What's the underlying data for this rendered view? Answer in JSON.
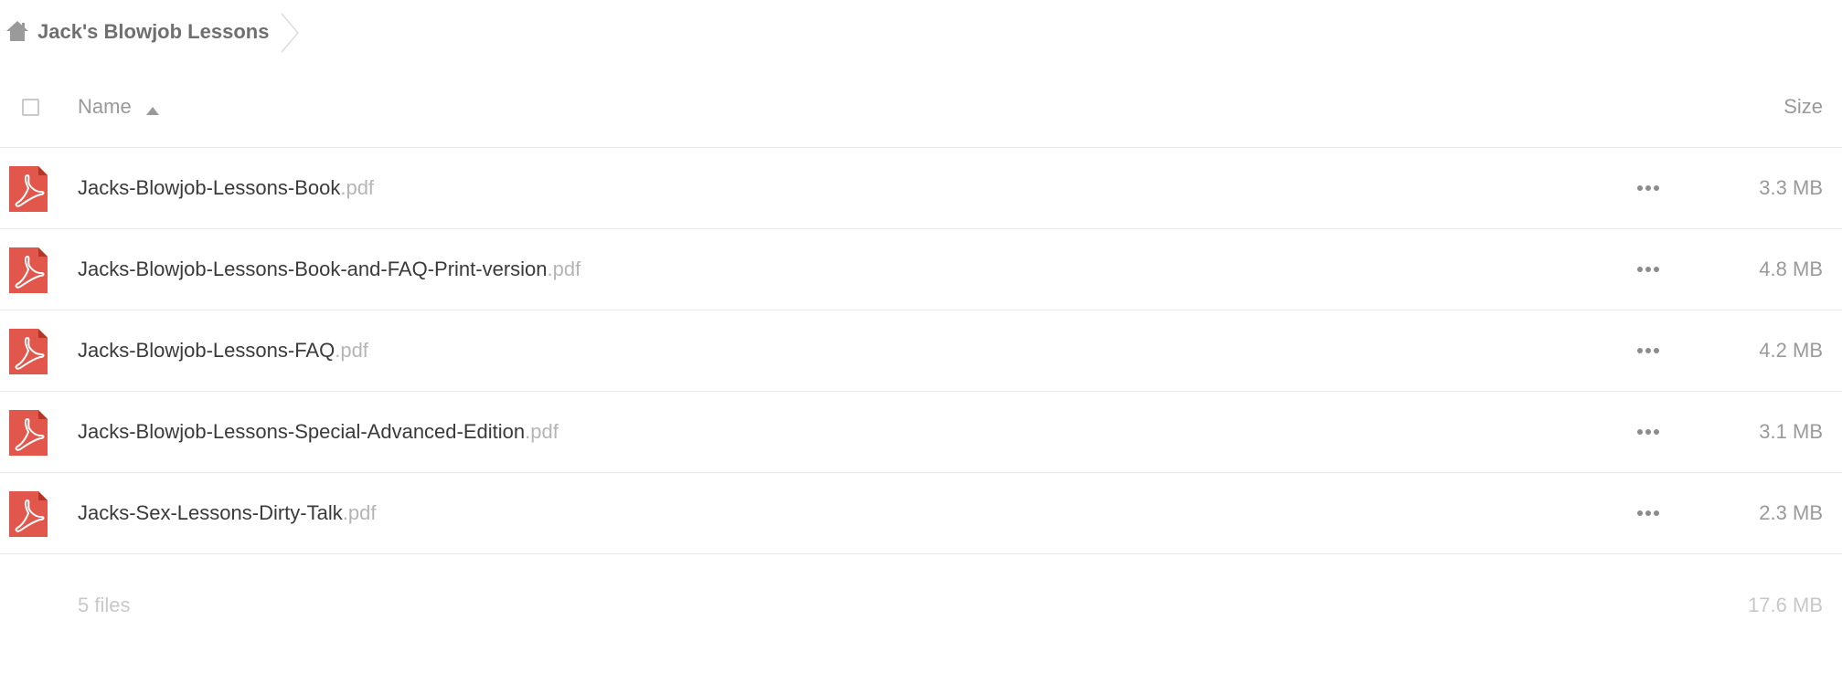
{
  "breadcrumb": {
    "home_icon": "home-icon",
    "current_folder": "Jack's Blowjob Lessons"
  },
  "header": {
    "name_label": "Name",
    "size_label": "Size",
    "sort_icon": "sort-ascending-icon"
  },
  "files": [
    {
      "base": "Jacks-Blowjob-Lessons-Book",
      "ext": ".pdf",
      "size": "3.3 MB",
      "icon": "pdf-file-icon"
    },
    {
      "base": "Jacks-Blowjob-Lessons-Book-and-FAQ-Print-version",
      "ext": ".pdf",
      "size": "4.8 MB",
      "icon": "pdf-file-icon"
    },
    {
      "base": "Jacks-Blowjob-Lessons-FAQ",
      "ext": ".pdf",
      "size": "4.2 MB",
      "icon": "pdf-file-icon"
    },
    {
      "base": "Jacks-Blowjob-Lessons-Special-Advanced-Edition",
      "ext": ".pdf",
      "size": "3.1 MB",
      "icon": "pdf-file-icon"
    },
    {
      "base": "Jacks-Sex-Lessons-Dirty-Talk",
      "ext": ".pdf",
      "size": "2.3 MB",
      "icon": "pdf-file-icon"
    }
  ],
  "summary": {
    "count": "5 files",
    "total_size": "17.6 MB"
  },
  "colors": {
    "pdf_red": "#e2574c",
    "icon_gray": "#9a9a9a"
  }
}
